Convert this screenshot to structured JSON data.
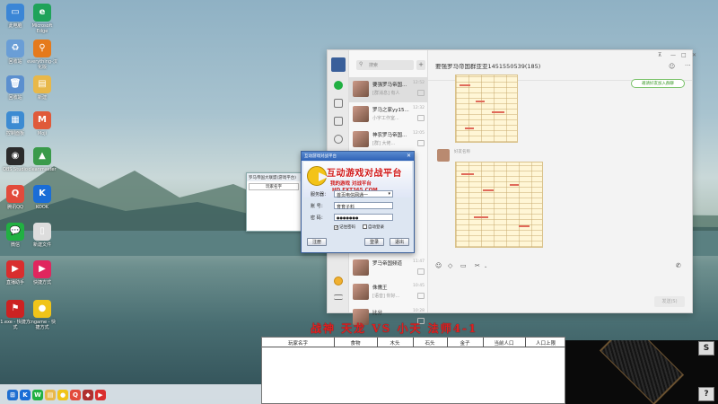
{
  "desktop": {
    "icons": [
      {
        "label": "此电脑",
        "name": "this-pc-icon",
        "color": "#3b86d6",
        "glyph": "▭"
      },
      {
        "label": "Microsoft Edge",
        "name": "edge-icon",
        "color": "#1fa35a",
        "glyph": "e"
      },
      {
        "label": "回收站",
        "name": "recycle-bin-icon",
        "color": "#6a9ed6",
        "glyph": "♻"
      },
      {
        "label": "everything-汉化版",
        "name": "everything-icon",
        "color": "#e57a1c",
        "glyph": "⚲"
      },
      {
        "label": "回收站",
        "name": "recycle-bin2-icon",
        "color": "#5b8fcf",
        "glyph": "🗑"
      },
      {
        "label": "新建",
        "name": "folder-icon",
        "color": "#e8b84a",
        "glyph": "▤"
      },
      {
        "label": "控制面板",
        "name": "control-panel-icon",
        "color": "#3c8bd2",
        "glyph": "▦"
      },
      {
        "label": "Moji",
        "name": "moji-icon",
        "color": "#e05a3a",
        "glyph": "M"
      },
      {
        "label": "OBS Studio",
        "name": "obs-icon",
        "color": "#2b2b2b",
        "glyph": "◉"
      },
      {
        "label": "cleanmaster",
        "name": "cleanmaster-icon",
        "color": "#3a9a4a",
        "glyph": "▲"
      },
      {
        "label": "腾讯QQ",
        "name": "qq-icon",
        "color": "#e24b3b",
        "glyph": "Q"
      },
      {
        "label": "KOOK",
        "name": "kook-icon",
        "color": "#1a6dd6",
        "glyph": "K"
      },
      {
        "label": "微信",
        "name": "wechat-icon",
        "color": "#21b042",
        "glyph": "💬"
      },
      {
        "label": "新建文件",
        "name": "file-icon",
        "color": "#dddddd",
        "glyph": "▯"
      },
      {
        "label": "直播助手",
        "name": "live-icon",
        "color": "#d92e2e",
        "glyph": "▶"
      },
      {
        "label": "快捷方式",
        "name": "shortcut-icon",
        "color": "#e0265e",
        "glyph": "▶"
      },
      {
        "label": "1.exe - 快捷方式",
        "name": "exe-icon",
        "color": "#c22",
        "glyph": "⚑"
      },
      {
        "label": "cngame - 快捷方式",
        "name": "cngame-icon",
        "color": "#f0c419",
        "glyph": "●"
      }
    ]
  },
  "chat": {
    "title": "要强罗马帝国群亚亚1451550539(185)",
    "search_placeholder": "搜索",
    "add_label": "+",
    "green_button": "邀请好友加入群聊",
    "send_label": "发送(S)",
    "friend_name": "好友名称",
    "window_controls": [
      "—",
      "□",
      "✕"
    ],
    "more_label": "···",
    "conversations": [
      {
        "title": "要强罗马帝国...",
        "subtitle": "[群消息] 有人",
        "time": "12:52"
      },
      {
        "title": "罗马之家yy15...",
        "subtitle": "小宇工作室...",
        "time": "12:32"
      },
      {
        "title": "神农罗马帝国...",
        "subtitle": "[群] 大佬...",
        "time": "12:05"
      },
      {
        "title": "罗马帝国频道",
        "subtitle": "",
        "time": "11:47"
      },
      {
        "title": "侏儒王",
        "subtitle": "[语音] 你好...",
        "time": "10:45"
      },
      {
        "title": "比分",
        "subtitle": "",
        "time": "10:28"
      }
    ]
  },
  "bg_dialog_left": {
    "title": "罗马帝国大联盟(游戏平台)",
    "header": "玩家名字"
  },
  "bg_dialog_right": {
    "close": "✕",
    "col1": "当前人口",
    "col2": "人口上限"
  },
  "login": {
    "title": "互动游戏对战平台",
    "banner_big": "互动游戏对战平台",
    "banner_small": "我的游戏 对战平台",
    "banner_url": "HD.FXT365.COM",
    "server_label": "服务器：",
    "server_value": "首页电信网通一",
    "account_label": "账 号：",
    "account_value": "育育子料",
    "password_label": "密 码：",
    "password_value": "●●●●●●●",
    "remember_label": "记住密码",
    "auto_label": "自动登录",
    "register_label": "注册",
    "login_label": "登录",
    "exit_label": "退出",
    "close": "✕"
  },
  "game": {
    "match_title": "战神 天龙 VS 小天 法师4-1",
    "columns": [
      "玩家名字",
      "食物",
      "木头",
      "石头",
      "金子",
      "当前人口",
      "人口上限"
    ],
    "button_s": "S",
    "button_q": "?"
  },
  "taskbar": {
    "items": [
      {
        "name": "start-icon",
        "glyph": "⊞",
        "color": "#1f6fd0"
      },
      {
        "name": "kook-task-icon",
        "glyph": "K",
        "color": "#1a6dd6"
      },
      {
        "name": "wechat-task-icon",
        "glyph": "W",
        "color": "#21b042"
      },
      {
        "name": "folder-task-icon",
        "glyph": "▤",
        "color": "#e8b84a"
      },
      {
        "name": "game-task-icon",
        "glyph": "●",
        "color": "#f0c419"
      },
      {
        "name": "qq-task-icon",
        "glyph": "Q",
        "color": "#e24b3b"
      },
      {
        "name": "app-task-icon",
        "glyph": "◆",
        "color": "#b03030"
      },
      {
        "name": "live-task-icon",
        "glyph": "▶",
        "color": "#d92e2e"
      }
    ]
  }
}
